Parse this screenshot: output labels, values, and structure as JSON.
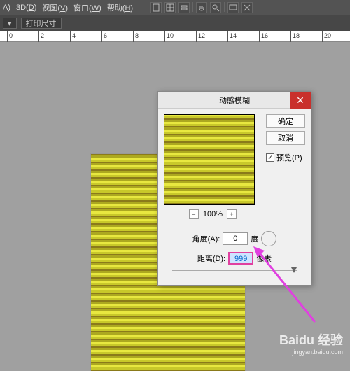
{
  "menubar": {
    "items": [
      {
        "label": "A",
        "hk": "A",
        "suffix": ")"
      },
      {
        "label": "3D",
        "hk": "D",
        "suffix": ")"
      },
      {
        "label": "视图",
        "hk": "V",
        "suffix": ")"
      },
      {
        "label": "窗口",
        "hk": "W",
        "suffix": ")"
      },
      {
        "label": "帮助",
        "hk": "H",
        "suffix": ")"
      }
    ]
  },
  "toolbar": {
    "print_size": "打印尺寸"
  },
  "ruler": {
    "marks": [
      0,
      2,
      4,
      6,
      8,
      10,
      12,
      14,
      16,
      18,
      20
    ]
  },
  "dialog": {
    "title": "动感模糊",
    "ok": "确定",
    "cancel": "取消",
    "preview_label": "预览(P)",
    "preview_checked": true,
    "zoom_pct": "100%",
    "angle_label": "角度(A):",
    "angle_value": "0",
    "angle_unit": "度",
    "distance_label": "距离(D):",
    "distance_value": "999",
    "distance_unit": "像素"
  },
  "watermark": {
    "brand": "Baidu 经验",
    "url": "jingyan.baidu.com"
  }
}
